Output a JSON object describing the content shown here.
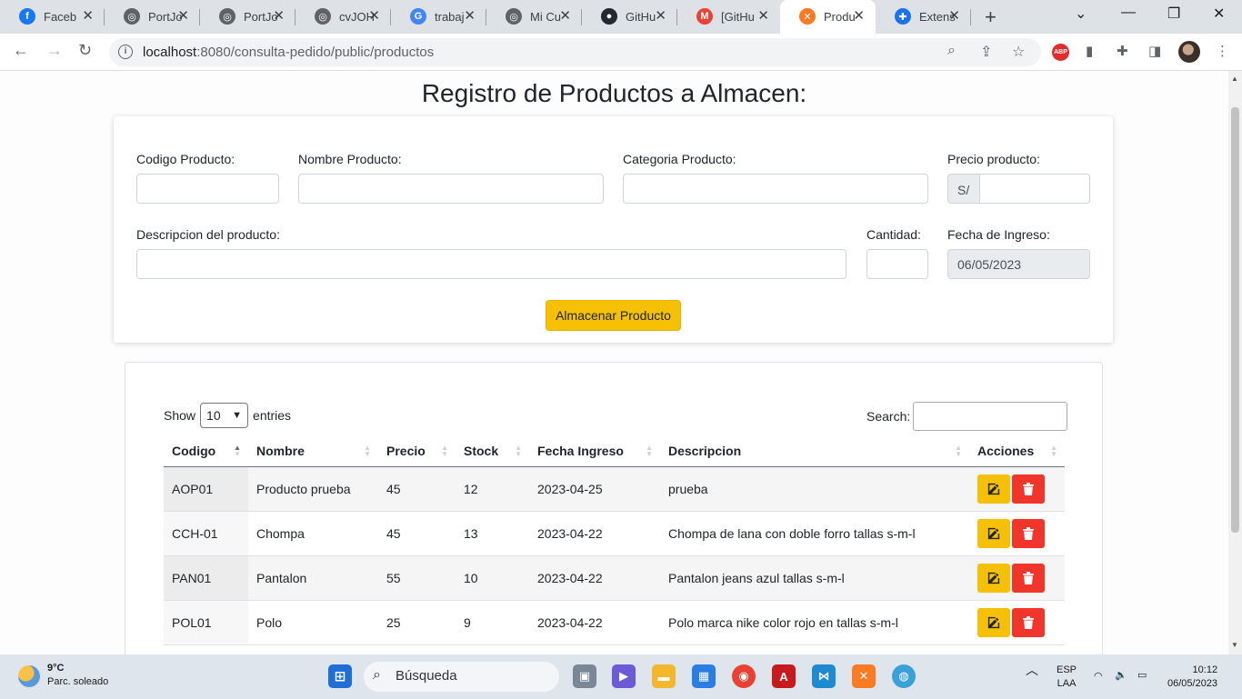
{
  "browser": {
    "tabs": [
      {
        "label": "Faceb",
        "icon": "facebook-icon",
        "color": "#1877f2",
        "glyph": "f"
      },
      {
        "label": "PortJo",
        "icon": "globe-icon",
        "color": "#5f6368",
        "glyph": "◎"
      },
      {
        "label": "PortJo",
        "icon": "globe-icon",
        "color": "#5f6368",
        "glyph": "◎"
      },
      {
        "label": "cvJOH",
        "icon": "globe-icon",
        "color": "#5f6368",
        "glyph": "◎"
      },
      {
        "label": "trabaj",
        "icon": "google-icon",
        "color": "#4285f4",
        "glyph": "G"
      },
      {
        "label": "Mi Cu",
        "icon": "globe-icon",
        "color": "#5f6368",
        "glyph": "◎"
      },
      {
        "label": "GitHu",
        "icon": "github-icon",
        "color": "#24292f",
        "glyph": "●"
      },
      {
        "label": "[GitHu",
        "icon": "gmail-icon",
        "color": "#ea4335",
        "glyph": "M"
      },
      {
        "label": "Produ",
        "icon": "xampp-icon",
        "color": "#fb7a24",
        "glyph": "✕"
      },
      {
        "label": "Extens",
        "icon": "puzzle-icon",
        "color": "#1a73e8",
        "glyph": "✚"
      }
    ],
    "url_host": "localhost",
    "url_rest": ":8080/consulta-pedido/public/productos"
  },
  "page": {
    "title": "Registro de Productos a Almacen:"
  },
  "form": {
    "codigo_label": "Codigo Producto:",
    "nombre_label": "Nombre Producto:",
    "categoria_label": "Categoria Producto:",
    "precio_label": "Precio producto:",
    "precio_prefix": "S/",
    "descripcion_label": "Descripcion del producto:",
    "cantidad_label": "Cantidad:",
    "fecha_label": "Fecha de Ingreso:",
    "fecha_value": "06/05/2023",
    "submit_label": "Almacenar Producto"
  },
  "table": {
    "show_label": "Show",
    "entries_value": "10",
    "entries_label": "entries",
    "search_label": "Search:",
    "headers": [
      "Codigo",
      "Nombre",
      "Precio",
      "Stock",
      "Fecha Ingreso",
      "Descripcion",
      "Acciones"
    ],
    "rows": [
      {
        "codigo": "AOP01",
        "nombre": "Producto prueba",
        "precio": "45",
        "stock": "12",
        "fecha": "2023-04-25",
        "descripcion": "prueba"
      },
      {
        "codigo": "CCH-01",
        "nombre": "Chompa",
        "precio": "45",
        "stock": "13",
        "fecha": "2023-04-22",
        "descripcion": "Chompa de lana con doble forro tallas s-m-l"
      },
      {
        "codigo": "PAN01",
        "nombre": "Pantalon",
        "precio": "55",
        "stock": "10",
        "fecha": "2023-04-22",
        "descripcion": "Pantalon jeans azul tallas s-m-l"
      },
      {
        "codigo": "POL01",
        "nombre": "Polo",
        "precio": "25",
        "stock": "9",
        "fecha": "2023-04-22",
        "descripcion": "Polo marca nike color rojo en tallas s-m-l"
      }
    ]
  },
  "taskbar": {
    "temp": "9°C",
    "weather": "Parc. soleado",
    "search": "Búsqueda",
    "lang1": "ESP",
    "lang2": "LAA",
    "time": "10:12",
    "date": "06/05/2023"
  }
}
